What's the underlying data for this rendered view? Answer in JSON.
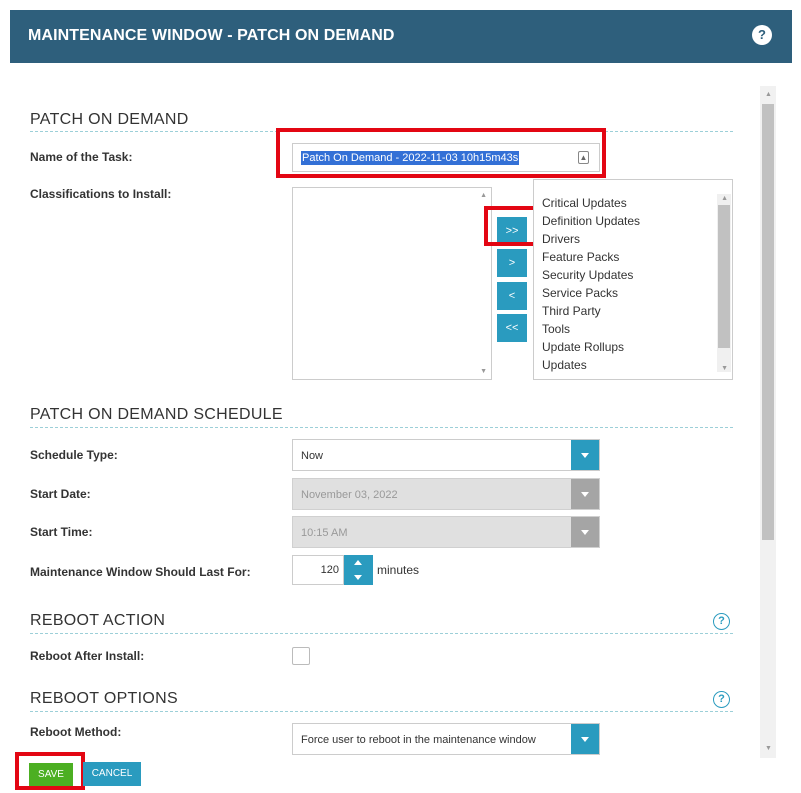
{
  "header": {
    "title": "MAINTENANCE WINDOW - PATCH ON DEMAND",
    "help": "?"
  },
  "sections": {
    "patch_on_demand": "PATCH ON DEMAND",
    "schedule": "PATCH ON DEMAND SCHEDULE",
    "reboot_action": "REBOOT ACTION",
    "reboot_options": "REBOOT OPTIONS"
  },
  "fields": {
    "task_name_label": "Name of the Task:",
    "task_name_value": "Patch On Demand - 2022-11-03 10h15m43s",
    "classifications_label": "Classifications to Install:",
    "schedule_type_label": "Schedule Type:",
    "schedule_type_value": "Now",
    "start_date_label": "Start Date:",
    "start_date_value": "November 03, 2022",
    "start_time_label": "Start Time:",
    "start_time_value": "10:15 AM",
    "duration_label": "Maintenance Window Should Last For:",
    "duration_value": "120",
    "duration_unit": "minutes",
    "reboot_after_label": "Reboot After Install:",
    "reboot_method_label": "Reboot Method:",
    "reboot_method_value": "Force user to reboot in the maintenance window"
  },
  "move_buttons": {
    "add_all": ">>",
    "add": ">",
    "remove": "<",
    "remove_all": "<<"
  },
  "available_classifications": [
    "Critical Updates",
    "Definition Updates",
    "Drivers",
    "Feature Packs",
    "Security Updates",
    "Service Packs",
    "Third Party",
    "Tools",
    "Update Rollups",
    "Updates"
  ],
  "buttons": {
    "save": "SAVE",
    "cancel": "CANCEL"
  },
  "help_icon": "?",
  "colors": {
    "header_bg": "#2e5f7c",
    "accent": "#2a9bbf",
    "save_green": "#4caf22",
    "highlight_red": "#e30613"
  }
}
